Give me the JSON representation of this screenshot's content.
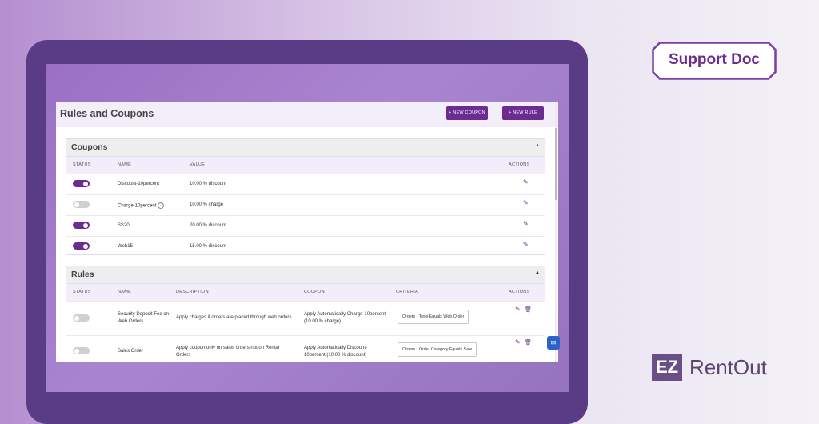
{
  "app": {
    "title": "Rules and Coupons",
    "new_coupon_label": "+ NEW COUPON",
    "new_rule_label": "+ NEW RULE"
  },
  "coupons": {
    "title": "Coupons",
    "columns": [
      "STATUS",
      "NAME",
      "VALUE",
      "ACTIONS"
    ],
    "rows": [
      {
        "enabled": true,
        "name": "Discount-10percent",
        "value": "10.00 % discount"
      },
      {
        "enabled": false,
        "name": "Charge-10percent",
        "value": "10.00 % charge"
      },
      {
        "enabled": true,
        "name": "SS20",
        "value": "20.00 % discount"
      },
      {
        "enabled": true,
        "name": "Web15",
        "value": "15.00 % discount"
      }
    ]
  },
  "rules": {
    "title": "Rules",
    "columns": [
      "STATUS",
      "NAME",
      "DESCRIPTION",
      "COUPON",
      "CRITERIA",
      "ACTIONS"
    ],
    "rows": [
      {
        "enabled": false,
        "name": "Security Deposit Fee on Web Orders",
        "description": "Apply charges if orders are placed through web orders",
        "coupon": "Apply Automatically Charge-10percent (10.00 % charge)",
        "criteria": "Orders - Type Equals Web Order"
      },
      {
        "enabled": false,
        "name": "Sales Order",
        "description": "Apply coupon only on sales orders not on Rental Orders",
        "coupon": "Apply Automatically Discount-10percent (10.00 % discount)",
        "criteria": "Orders - Order Category Equals Sale"
      }
    ]
  },
  "badge": {
    "label": "Support Doc"
  },
  "logo": {
    "mark": "EZ",
    "name": "RentOut"
  },
  "colors": {
    "accent": "#6a2c91",
    "toggle_off": "#cfcfd4"
  },
  "icons": {
    "edit": "pencil-icon",
    "delete": "trash-icon",
    "info": "info-icon",
    "chat": "chat-icon"
  }
}
